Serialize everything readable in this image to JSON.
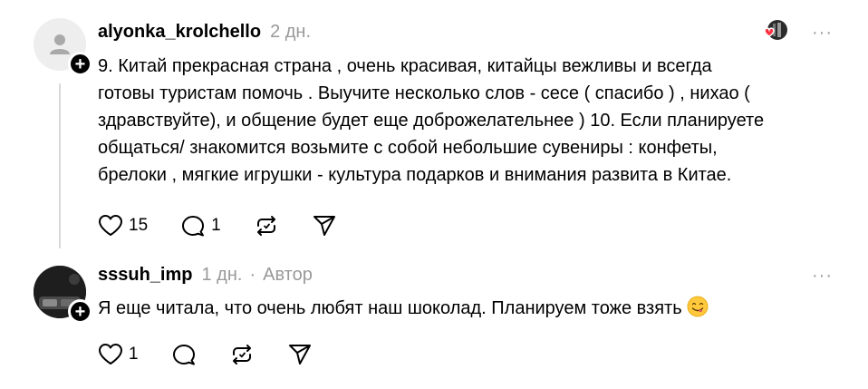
{
  "thread": [
    {
      "username": "alyonka_krolchello",
      "time": "2 дн.",
      "text_lines": [
        "9. Китай прекрасная страна , очень красивая, китайцы вежливы и всегда",
        "готовы туристам помочь . Выучите несколько слов - сесе ( спасибо ) , нихао (",
        "здравствуйте), и общение будет еще доброжелательнее ) 10. Если планируете",
        "общаться/ знакомится возьмите с собой небольшие сувениры : конфеты,",
        "брелоки , мягкие игрушки - культура подарков и внимания развита в Китае."
      ],
      "likes": "15",
      "replies": "1",
      "more": "···",
      "plus": "+"
    },
    {
      "username": "sssuh_imp",
      "time": "1 дн.",
      "separator": "·",
      "author_label": "Автор",
      "text": "Я еще читала, что очень любят наш шоколад. Планируем тоже взять",
      "likes": "1",
      "more": "···",
      "plus": "+"
    }
  ],
  "icons": {
    "like": "heart-icon",
    "reply": "comment-icon",
    "repost": "repost-icon",
    "share": "share-icon",
    "emoji": "yum-face-emoji"
  },
  "colors": {
    "text": "#000000",
    "muted": "#999999",
    "thread_line": "#d9d9d9",
    "liked_heart": "#ff3040"
  }
}
